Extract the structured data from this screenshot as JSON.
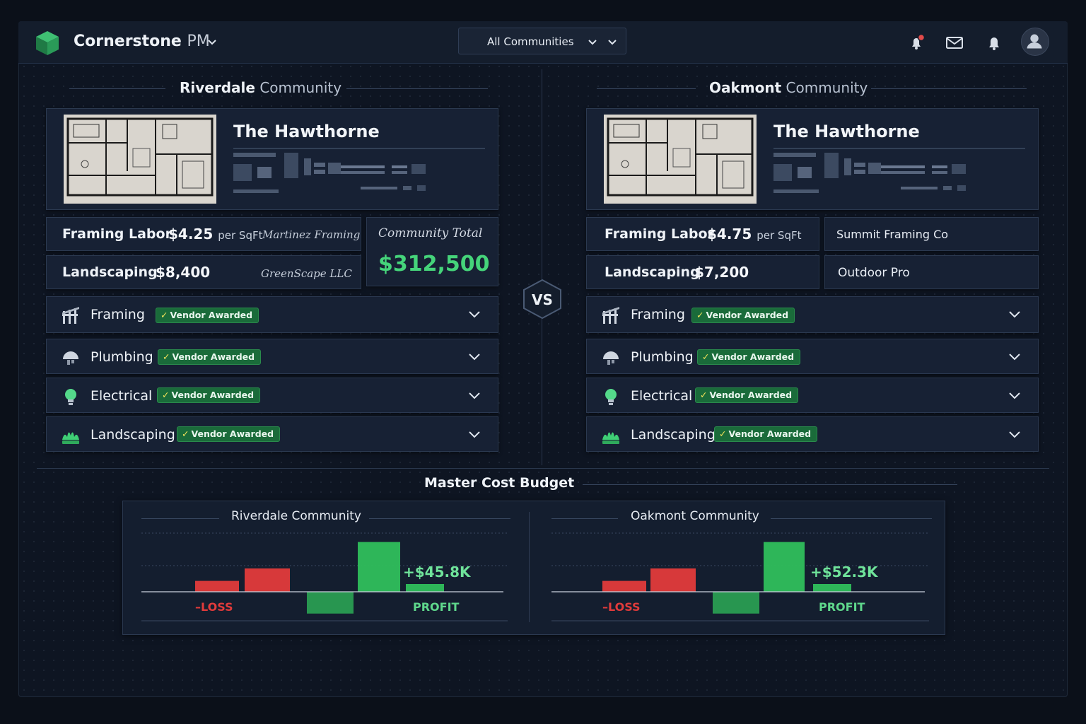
{
  "header": {
    "brand_main": "Cornerstone",
    "brand_suffix": "PM",
    "community_selector": "All Communities",
    "icons": [
      "cube-logo-icon",
      "chevron-down-icon",
      "alert-bell-icon",
      "mail-icon",
      "bell-icon",
      "user-avatar-icon"
    ]
  },
  "vs_label": "VS",
  "communities": [
    {
      "name": "Riverdale",
      "suffix": "Community",
      "plan_name": "The Hawthorne",
      "framing": {
        "label": "Framing Labor",
        "amount": "$4.25",
        "unit": "per SqFt",
        "vendor": "Martinez Framing"
      },
      "landscaping": {
        "label": "Landscaping",
        "amount": "$8,400",
        "vendor": "GreenScape LLC"
      },
      "total": {
        "label": "Community Total",
        "value": "$312,500"
      },
      "trades": [
        {
          "name": "Framing",
          "badge": "Vendor Awarded",
          "icon": "framing-icon"
        },
        {
          "name": "Plumbing",
          "badge": "Vendor Awarded",
          "icon": "plumbing-icon"
        },
        {
          "name": "Electrical",
          "badge": "Vendor Awarded",
          "icon": "lightbulb-icon"
        },
        {
          "name": "Landscaping",
          "badge": "Vendor Awarded",
          "icon": "shrub-icon"
        }
      ]
    },
    {
      "name": "Oakmont",
      "suffix": "Community",
      "plan_name": "The Hawthorne",
      "framing": {
        "label": "Framing Labor",
        "amount": "$4.75",
        "unit": "per SqFt",
        "vendor": "Summit Framing Co"
      },
      "landscaping": {
        "label": "Landscaping",
        "amount": "$7,200",
        "vendor": "Outdoor Pro"
      },
      "trades": [
        {
          "name": "Framing",
          "badge": "Vendor Awarded",
          "icon": "framing-icon"
        },
        {
          "name": "Plumbing",
          "badge": "Vendor Awarded",
          "icon": "plumbing-icon"
        },
        {
          "name": "Electrical",
          "badge": "Vendor Awarded",
          "icon": "lightbulb-icon"
        },
        {
          "name": "Landscaping",
          "badge": "Vendor Awarded",
          "icon": "shrub-icon"
        }
      ]
    }
  ],
  "budget": {
    "title": "Master Cost Budget",
    "colors": {
      "loss": "#e23b3b",
      "profit": "#2fbf5c"
    }
  },
  "chart_data": [
    {
      "type": "bar",
      "title": "Riverdale Community",
      "values": [
        -0.35,
        -0.75,
        0.7,
        1.6,
        -0.25
      ],
      "annotation": "+$45.8K",
      "loss_label": "–LOSS",
      "profit_label": "PROFIT"
    },
    {
      "type": "bar",
      "title": "Oakmont Community",
      "values": [
        -0.35,
        -0.75,
        0.7,
        1.6,
        -0.25
      ],
      "annotation": "+$52.3K",
      "loss_label": "–LOSS",
      "profit_label": "PROFIT"
    }
  ]
}
